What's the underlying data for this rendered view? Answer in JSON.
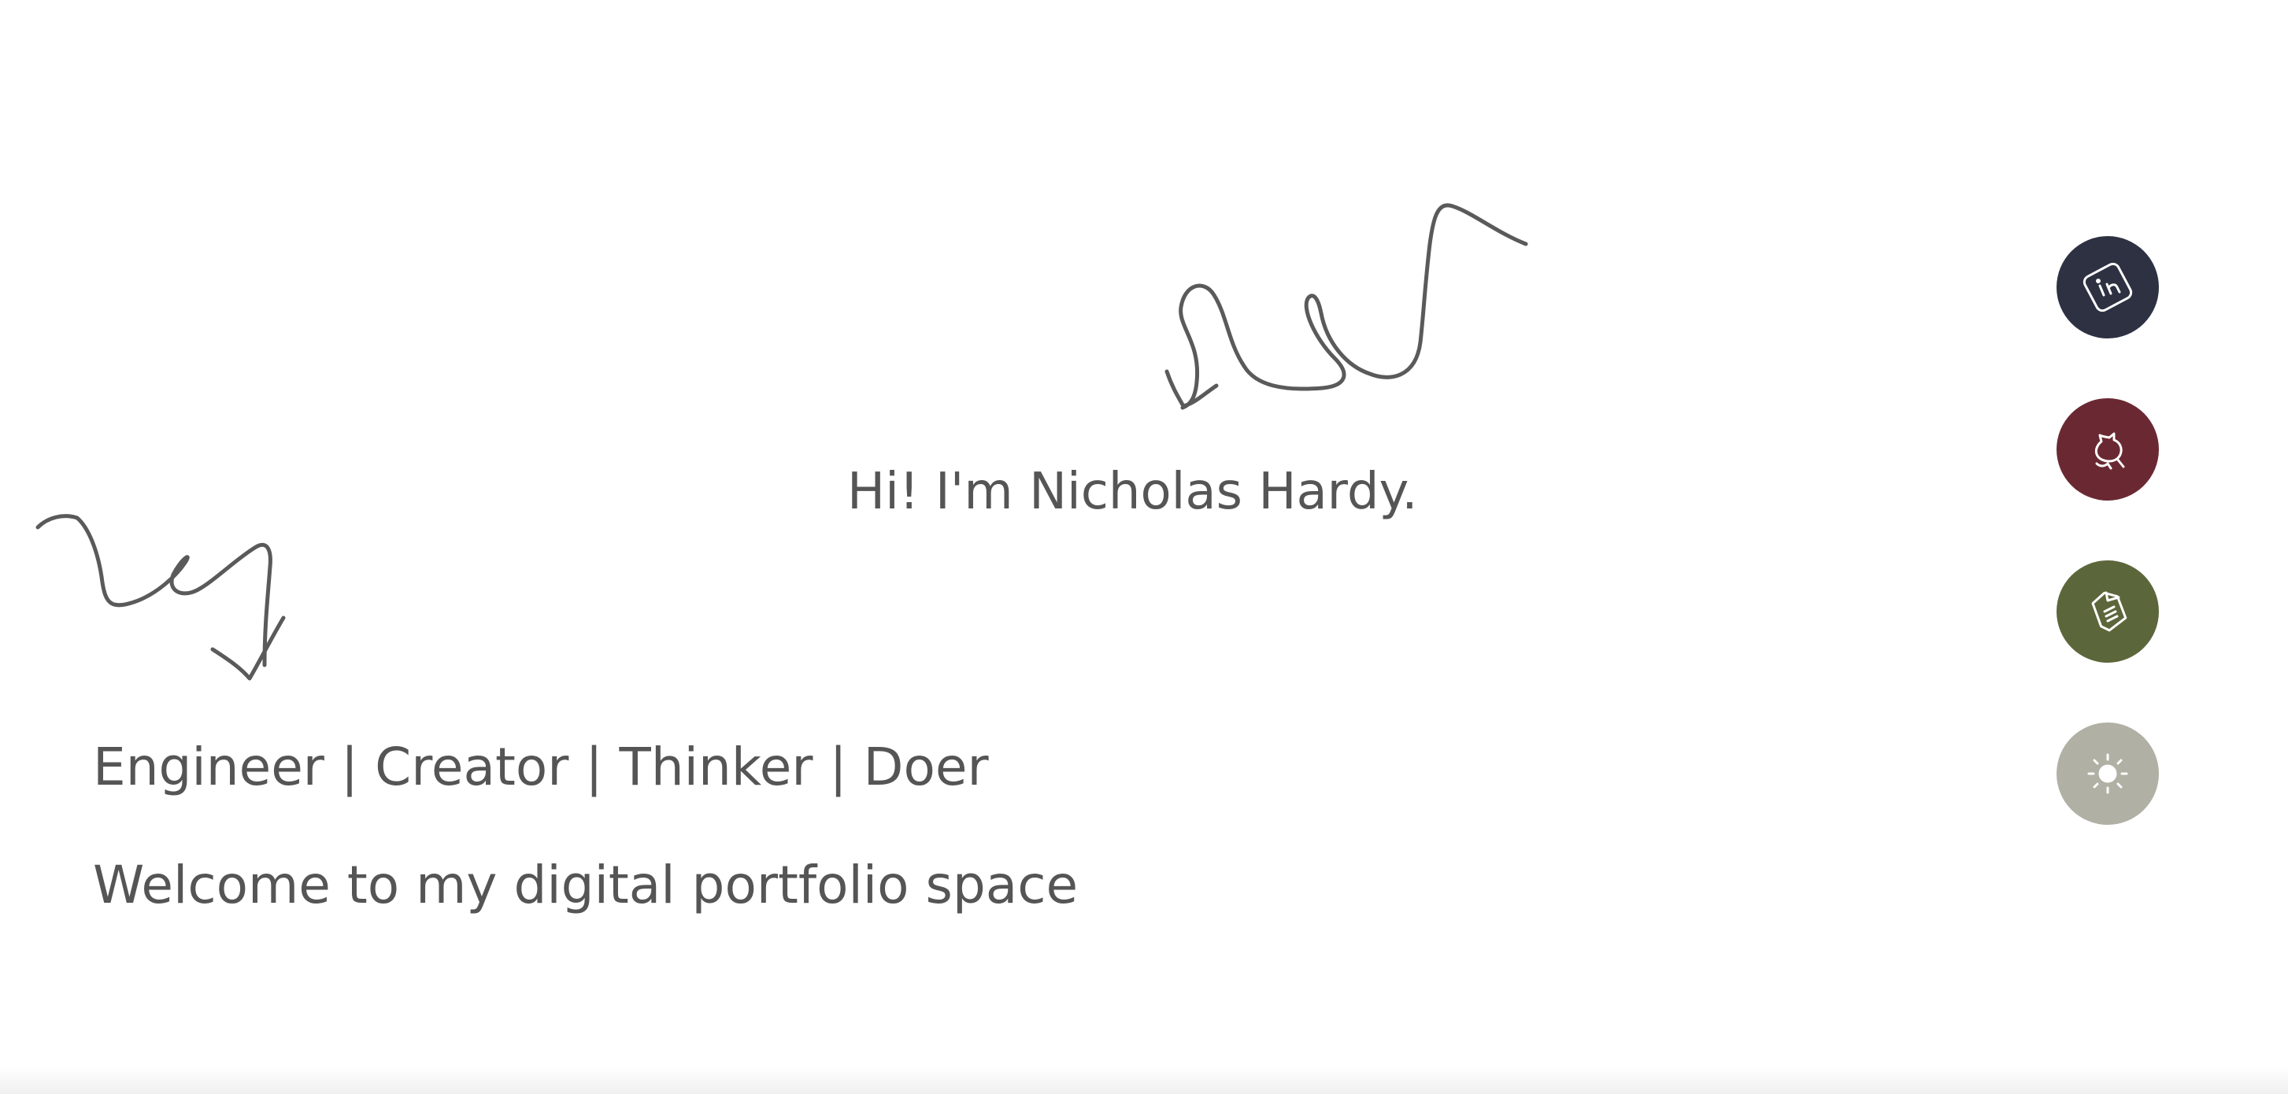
{
  "hero": {
    "greeting": "Hi! I'm Nicholas Hardy.",
    "tagline": "Engineer | Creator | Thinker | Doer",
    "welcome": "Welcome to my digital portfolio space"
  },
  "social_links": [
    {
      "icon": "linkedin-icon",
      "color": "#2d3142"
    },
    {
      "icon": "github-icon",
      "color": "#6a2932"
    },
    {
      "icon": "resume-icon",
      "color": "#5c663b"
    },
    {
      "icon": "sun-icon",
      "color": "#b0b0a4"
    }
  ],
  "colors": {
    "text": "#555555",
    "background": "#ffffff"
  }
}
